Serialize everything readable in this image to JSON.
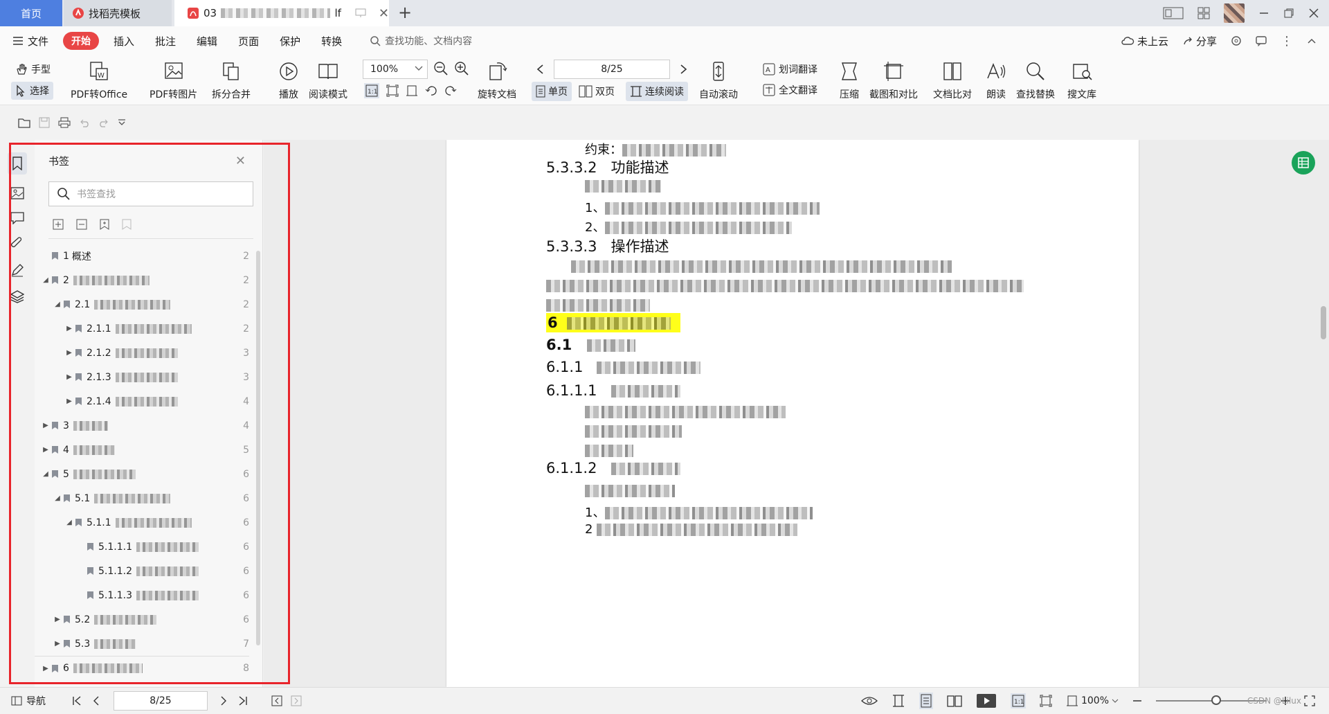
{
  "tabs": {
    "home": "首页",
    "templates": "找稻壳模板",
    "document": "03",
    "document_suffix": "lf"
  },
  "menu": {
    "file": "文件",
    "start": "开始",
    "items": [
      "插入",
      "批注",
      "编辑",
      "页面",
      "保护",
      "转换"
    ],
    "search_placeholder": "查找功能、文档内容",
    "cloud": "未上云",
    "share": "分享"
  },
  "ribbon": {
    "hand": "手型",
    "select": "选择",
    "pdf_office": "PDF转Office",
    "pdf_image": "PDF转图片",
    "split_merge": "拆分合并",
    "play": "播放",
    "read_mode": "阅读模式",
    "zoom": "100%",
    "rotate": "旋转文档",
    "page_input": "8/25",
    "single": "单页",
    "double": "双页",
    "continuous": "连续阅读",
    "autoscroll": "自动滚动",
    "word_translate": "划词翻译",
    "full_translate": "全文翻译",
    "compress": "压缩",
    "screenshot_compare": "截图和对比",
    "doc_compare": "文档比对",
    "read_aloud": "朗读",
    "find_replace": "查找替换",
    "search_library": "搜文库"
  },
  "bookmarks": {
    "title": "书签",
    "search_placeholder": "书签查找",
    "items": [
      {
        "num": "1",
        "text": "概述",
        "page": "2",
        "level": 0,
        "arrow": ""
      },
      {
        "num": "2",
        "text": "",
        "page": "2",
        "level": 0,
        "arrow": "◢"
      },
      {
        "num": "2.1",
        "text": "",
        "page": "2",
        "level": 1,
        "arrow": "◢"
      },
      {
        "num": "2.1.1",
        "text": "",
        "page": "2",
        "level": 2,
        "arrow": "▶"
      },
      {
        "num": "2.1.2",
        "text": "",
        "page": "3",
        "level": 2,
        "arrow": "▶"
      },
      {
        "num": "2.1.3",
        "text": "",
        "page": "3",
        "level": 2,
        "arrow": "▶"
      },
      {
        "num": "2.1.4",
        "text": "",
        "page": "4",
        "level": 2,
        "arrow": "▶"
      },
      {
        "num": "3",
        "text": "",
        "page": "4",
        "level": 0,
        "arrow": "▶"
      },
      {
        "num": "4",
        "text": "",
        "page": "5",
        "level": 0,
        "arrow": "▶"
      },
      {
        "num": "5",
        "text": "",
        "page": "6",
        "level": 0,
        "arrow": "◢"
      },
      {
        "num": "5.1",
        "text": "",
        "page": "6",
        "level": 1,
        "arrow": "◢"
      },
      {
        "num": "5.1.1",
        "text": "",
        "page": "6",
        "level": 2,
        "arrow": "◢"
      },
      {
        "num": "5.1.1.1",
        "text": "",
        "page": "6",
        "level": 3,
        "arrow": ""
      },
      {
        "num": "5.1.1.2",
        "text": "",
        "page": "6",
        "level": 3,
        "arrow": ""
      },
      {
        "num": "5.1.1.3",
        "text": "",
        "page": "6",
        "level": 3,
        "arrow": ""
      },
      {
        "num": "5.2",
        "text": "",
        "page": "6",
        "level": 1,
        "arrow": "▶"
      },
      {
        "num": "5.3",
        "text": "",
        "page": "7",
        "level": 1,
        "arrow": "▶"
      },
      {
        "num": "6",
        "text": "",
        "page": "8",
        "level": 0,
        "arrow": "▶"
      }
    ]
  },
  "document": {
    "constraint_label": "约束：",
    "h_5332": "5.3.3.2",
    "h_5332_text": "功能描述",
    "item1": "1、",
    "item2": "2、",
    "h_5333": "5.3.3.3",
    "h_5333_text": "操作描述",
    "h_6": "6",
    "h_61": "6.1",
    "h_611": "6.1.1",
    "h_6111": "6.1.1.1",
    "h_6112": "6.1.1.2",
    "item1b": "1、",
    "item2b": "2"
  },
  "status": {
    "nav": "导航",
    "page": "8/25",
    "zoom": "100%",
    "watermark": "CSDN @Lilux"
  },
  "colors": {
    "home_tab": "#4e7fe0",
    "start_button": "#e84545",
    "highlight": "#ffff1a",
    "red_frame": "#e8242b"
  }
}
